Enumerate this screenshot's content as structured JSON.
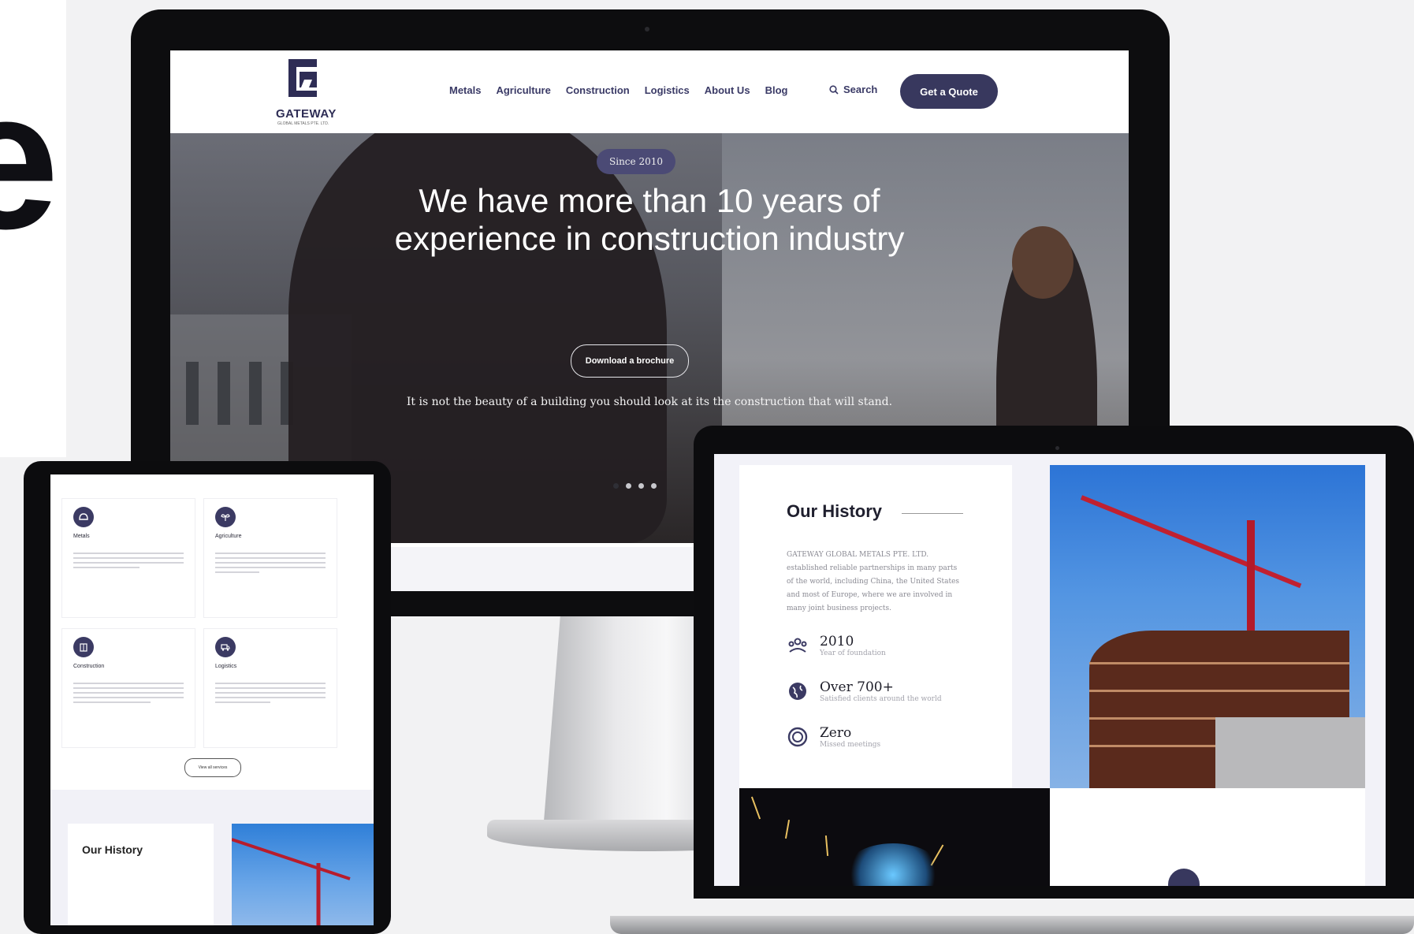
{
  "decor": {
    "big_letter": "e"
  },
  "site": {
    "logo": {
      "name": "GATEWAY",
      "sub": "GLOBAL METALS PTE. LTD."
    },
    "nav": [
      "Metals",
      "Agriculture",
      "Construction",
      "Logistics",
      "About Us",
      "Blog"
    ],
    "search_label": "Search",
    "quote_button": "Get a Quote",
    "hero": {
      "badge": "Since 2010",
      "title_line1": "We have more than 10 years of",
      "title_line2": "experience in construction industry",
      "button": "Download a brochure",
      "quote": "It is not the beauty of a building you should look at its the construction that will stand.",
      "slides_total": 4,
      "slide_active": 1
    }
  },
  "tablet": {
    "cards": [
      {
        "title": "Metals",
        "icon": "helmet-icon"
      },
      {
        "title": "Agriculture",
        "icon": "plant-icon"
      },
      {
        "title": "Construction",
        "icon": "building-icon"
      },
      {
        "title": "Logistics",
        "icon": "truck-icon"
      }
    ],
    "more_button": "View all services",
    "history_title": "Our History"
  },
  "laptop": {
    "history_title": "Our History",
    "history_text": "GATEWAY GLOBAL METALS PTE. LTD. established reliable partnerships in many parts of the world, including China, the United States and most of Europe, where we are involved in many joint business projects.",
    "stats": [
      {
        "value": "2010",
        "label": "Year of foundation",
        "icon": "team-icon"
      },
      {
        "value": "Over 700+",
        "label": "Satisfied clients around the world",
        "icon": "globe-icon"
      },
      {
        "value": "Zero",
        "label": "Missed meetings",
        "icon": "clock-icon"
      }
    ]
  },
  "colors": {
    "brand": "#38385e",
    "dark": "#0c0c0e"
  }
}
